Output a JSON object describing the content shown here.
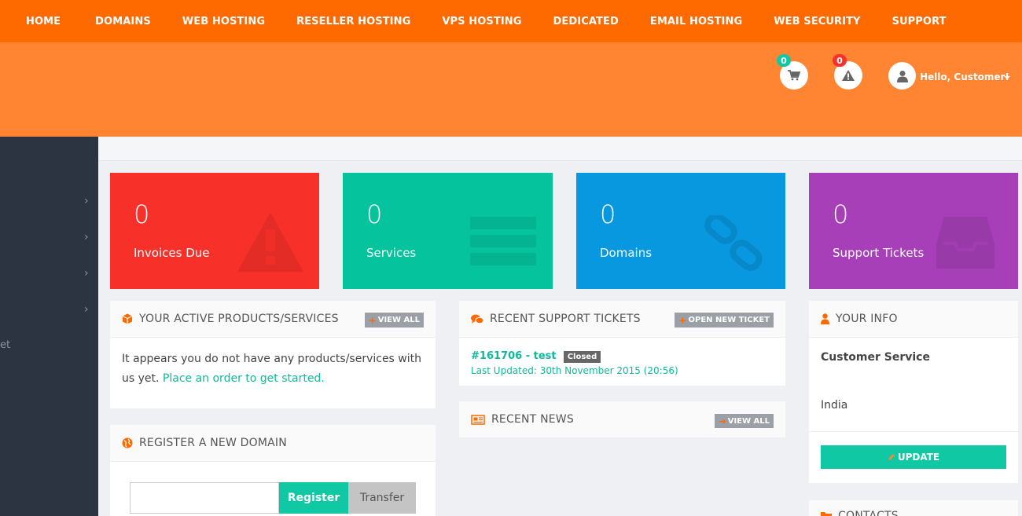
{
  "nav": {
    "items": [
      "HOME",
      "DOMAINS",
      "WEB HOSTING",
      "RESELLER HOSTING",
      "VPS HOSTING",
      "DEDICATED",
      "EMAIL HOSTING",
      "WEB SECURITY",
      "SUPPORT"
    ]
  },
  "header": {
    "cart_count": "0",
    "alert_count": "0",
    "greeting": "Hello, Customer!"
  },
  "sidebar": {
    "partial_text": "et"
  },
  "tiles": [
    {
      "count": "0",
      "label": "Invoices Due",
      "color": "#f7302a",
      "icon": "warning-icon"
    },
    {
      "count": "0",
      "label": "Services",
      "color": "#05c39c",
      "icon": "server-icon"
    },
    {
      "count": "0",
      "label": "Domains",
      "color": "#0898e0",
      "icon": "link-icon"
    },
    {
      "count": "0",
      "label": "Support Tickets",
      "color": "#a63fb8",
      "icon": "inbox-icon"
    }
  ],
  "products": {
    "title": "YOUR ACTIVE PRODUCTS/SERVICES",
    "button": "VIEW ALL",
    "empty_text": "It appears you do not have any products/services with us yet.",
    "link_text": "Place an order to get started."
  },
  "tickets": {
    "title": "RECENT SUPPORT TICKETS",
    "button": "OPEN NEW TICKET",
    "ticket_title": "#161706 - test",
    "ticket_status": "Closed",
    "ticket_updated": "Last Updated: 30th November 2015 (20:56)"
  },
  "news": {
    "title": "RECENT NEWS",
    "button": "VIEW ALL"
  },
  "info": {
    "title": "YOUR INFO",
    "name": "Customer Service",
    "country": "India",
    "button": "UPDATE"
  },
  "domain": {
    "title": "REGISTER A NEW DOMAIN",
    "register": "Register",
    "transfer": "Transfer"
  },
  "contacts": {
    "title": "CONTACTS"
  },
  "colors": {
    "accent": "#ff6a00",
    "teal": "#10c9a4"
  }
}
